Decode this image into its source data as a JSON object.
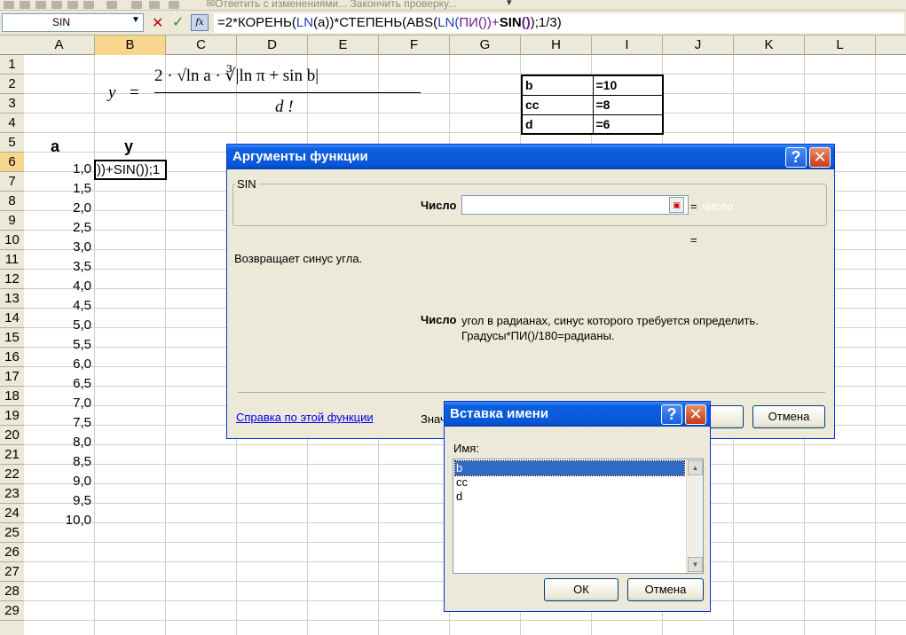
{
  "toolbar": {
    "reply_with_changes": "✉Ответить с изменениями... Закончить проверку...",
    "dropdown_glyph": "▾"
  },
  "formula_bar": {
    "name_box": "SIN",
    "cancel_glyph": "✕",
    "enter_glyph": "✓",
    "fx_label": "fx",
    "formula_parts": [
      "=2*КОРЕНЬ(",
      "LN",
      "(a))*СТЕПЕНЬ(ABS(",
      "LN",
      "(",
      "ПИ",
      "())+",
      "SIN",
      "()",
      ");1/3)"
    ]
  },
  "sheet": {
    "columns": [
      "A",
      "B",
      "C",
      "D",
      "E",
      "F",
      "G",
      "H",
      "I",
      "J",
      "K",
      "L"
    ],
    "active_column": "B",
    "rows": [
      "1",
      "2",
      "3",
      "4",
      "5",
      "6",
      "7",
      "8",
      "9",
      "10",
      "11",
      "12",
      "13",
      "14",
      "15",
      "16",
      "17",
      "18",
      "19",
      "20",
      "21",
      "22",
      "23",
      "24",
      "25",
      "26",
      "27",
      "28",
      "29"
    ],
    "active_row": "6",
    "header_a": "a",
    "header_y": "y",
    "a_values": [
      "1,0",
      "1,5",
      "2,0",
      "2,5",
      "3,0",
      "3,5",
      "4,0",
      "4,5",
      "5,0",
      "5,5",
      "6,0",
      "6,5",
      "7,0",
      "7,5",
      "8,0",
      "8,5",
      "9,0",
      "9,5",
      "10,0"
    ],
    "active_cell_text": "))+SIN());1"
  },
  "formula_image": {
    "y": "y",
    "eq": "=",
    "num": "2 · √ln a · ∛|ln π + sin b|",
    "den": "d !"
  },
  "variables": [
    {
      "name": "b",
      "value": "=10"
    },
    {
      "name": "cc",
      "value": "=8"
    },
    {
      "name": "d",
      "value": "=6"
    }
  ],
  "function_args_dialog": {
    "title": "Аргументы функции",
    "function_name": "SIN",
    "arg_label": "Число",
    "arg_value": "",
    "arg_hint": "число",
    "eq": "=",
    "description": "Возвращает синус угла.",
    "arg_desc_name": "Число",
    "arg_desc_line1": "угол в радианах, синус которого требуется определить.",
    "arg_desc_line2": "Градусы*ПИ()/180=радианы.",
    "help_link": "Справка по этой функции",
    "value_label": "Знач",
    "ok_label": "",
    "cancel_label": "Отмена"
  },
  "name_insert_dialog": {
    "title": "Вставка имени",
    "name_label": "Имя:",
    "names": [
      "b",
      "cc",
      "d"
    ],
    "selected": "b",
    "ok_label": "ОК",
    "cancel_label": "Отмена"
  },
  "colors": {
    "title_bar": "#0a58d8",
    "selection": "#316ac5",
    "active_header": "#f9d68d",
    "ln_color": "#1f3cb5",
    "pi_color": "#6a1b8a"
  }
}
